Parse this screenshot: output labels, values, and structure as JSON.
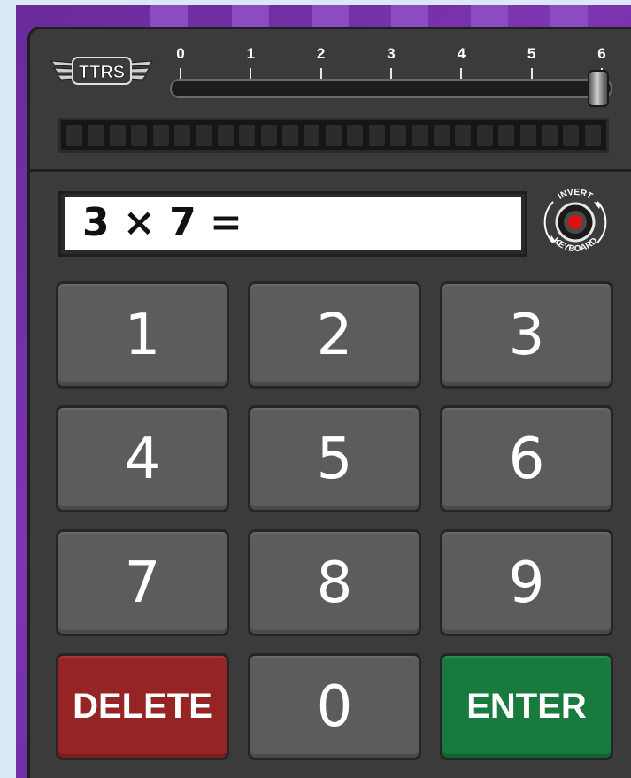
{
  "app": {
    "logo_text": "TTRS"
  },
  "slider": {
    "labels": [
      "0",
      "1",
      "2",
      "3",
      "4",
      "5",
      "6"
    ],
    "value": 6
  },
  "display": {
    "question": "3 × 7 ="
  },
  "invert_keyboard": {
    "top_label": "INVERT",
    "bottom_label": "KEYBOARD",
    "indicator_color": "#e01010"
  },
  "keypad": {
    "keys": [
      "1",
      "2",
      "3",
      "4",
      "5",
      "6",
      "7",
      "8",
      "9"
    ],
    "delete_label": "DELETE",
    "zero_label": "0",
    "enter_label": "ENTER"
  },
  "colors": {
    "delete": "#962424",
    "enter": "#197a3d",
    "key": "#5c5c5c",
    "background": "#7b35b0"
  }
}
